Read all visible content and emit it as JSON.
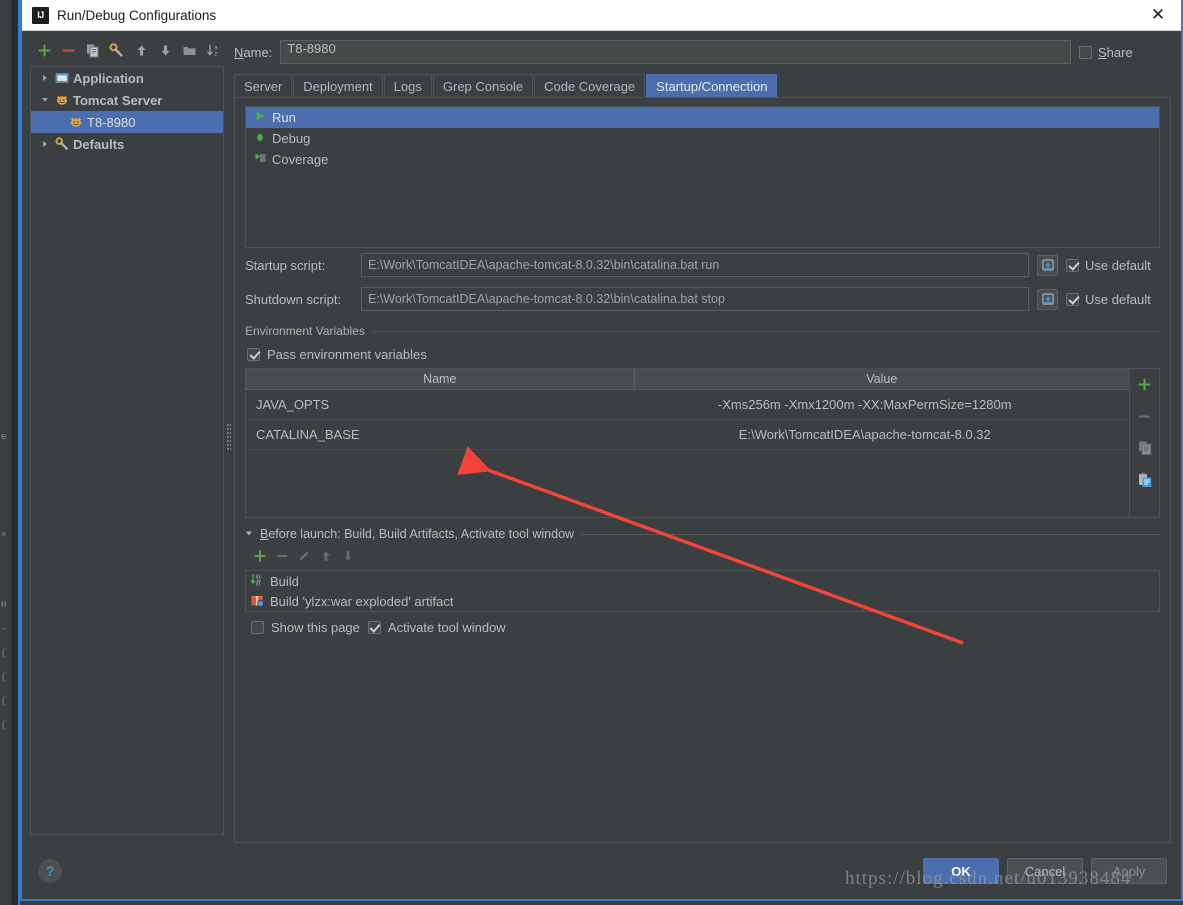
{
  "window": {
    "title": "Run/Debug Configurations",
    "icon": "intellij-idea-icon",
    "close_label": "✕"
  },
  "accent": {
    "selection_blue": "#4b6eaf",
    "border_blue": "#2d7fd0",
    "panel_bg": "#3c3f41",
    "text": "#bbbbbb",
    "green": "#4caf50",
    "red_arrow": "#f4443a"
  },
  "left_panel": {
    "toolbar": [
      {
        "name": "add-configuration-button",
        "icon": "plus-icon",
        "label": "+"
      },
      {
        "name": "remove-configuration-button",
        "icon": "minus-icon",
        "label": "−"
      },
      {
        "name": "copy-configuration-button",
        "icon": "copy-icon",
        "label": ""
      },
      {
        "name": "edit-defaults-button",
        "icon": "wrench-icon",
        "label": ""
      },
      {
        "name": "move-up-button",
        "icon": "arrow-up-icon",
        "label": ""
      },
      {
        "name": "move-down-button",
        "icon": "arrow-down-icon",
        "label": ""
      },
      {
        "name": "create-folder-button",
        "icon": "folder-icon",
        "label": ""
      },
      {
        "name": "sort-alphabetically-button",
        "icon": "sort-az-icon",
        "label": ""
      }
    ],
    "tree": [
      {
        "label": "Application",
        "icon": "application-icon",
        "twisty": "collapsed",
        "level": 0,
        "selected": false
      },
      {
        "label": "Tomcat Server",
        "icon": "tomcat-icon",
        "twisty": "expanded",
        "level": 0,
        "selected": false
      },
      {
        "label": "T8-8980",
        "icon": "tomcat-icon",
        "twisty": "none",
        "level": 1,
        "selected": true
      },
      {
        "label": "Defaults",
        "icon": "wrench-icon",
        "twisty": "collapsed",
        "level": 0,
        "selected": false
      }
    ]
  },
  "name_row": {
    "label": "Name:",
    "label_mnemonic": "N",
    "value": "T8-8980",
    "placeholder": "",
    "share_label": "Share",
    "share_mnemonic": "S",
    "share_checked": false
  },
  "tabs": [
    {
      "label": "Server",
      "active": false
    },
    {
      "label": "Deployment",
      "active": false
    },
    {
      "label": "Logs",
      "active": false
    },
    {
      "label": "Grep Console",
      "active": false
    },
    {
      "label": "Code Coverage",
      "active": false
    },
    {
      "label": "Startup/Connection",
      "active": true
    }
  ],
  "startup_connection": {
    "modes": [
      {
        "label": "Run",
        "icon": "run-triangle-icon",
        "selected": true
      },
      {
        "label": "Debug",
        "icon": "debug-bug-icon",
        "selected": false
      },
      {
        "label": "Coverage",
        "icon": "coverage-icon",
        "selected": false
      }
    ],
    "startup_script": {
      "label": "Startup script:",
      "value": "E:\\Work\\TomcatIDEA\\apache-tomcat-8.0.32\\bin\\catalina.bat run",
      "browse_icon": "browse-folder-icon",
      "use_default_label": "Use default",
      "use_default_checked": true
    },
    "shutdown_script": {
      "label": "Shutdown script:",
      "value": "E:\\Work\\TomcatIDEA\\apache-tomcat-8.0.32\\bin\\catalina.bat stop",
      "browse_icon": "browse-folder-icon",
      "use_default_label": "Use default",
      "use_default_checked": true
    },
    "environment_variables": {
      "section_title": "Environment Variables",
      "pass_env_label": "Pass environment variables",
      "pass_env_checked": true,
      "columns": [
        "Name",
        "Value"
      ],
      "rows": [
        {
          "name": "JAVA_OPTS",
          "value": "-Xms256m -Xmx1200m -XX:MaxPermSize=1280m"
        },
        {
          "name": "CATALINA_BASE",
          "value": "E:\\Work\\TomcatIDEA\\apache-tomcat-8.0.32"
        }
      ],
      "side_buttons": [
        {
          "name": "add-env-variable-button",
          "icon": "plus-icon"
        },
        {
          "name": "remove-env-variable-button",
          "icon": "minus-icon"
        },
        {
          "name": "copy-env-variable-button",
          "icon": "copy-icon"
        },
        {
          "name": "paste-env-variable-button",
          "icon": "paste-icon"
        }
      ]
    }
  },
  "before_launch": {
    "title": "Before launch: Build, Build Artifacts, Activate tool window",
    "title_mnemonic": "B",
    "toolbar": [
      {
        "name": "add-task-button",
        "icon": "plus-icon",
        "enabled": true
      },
      {
        "name": "remove-task-button",
        "icon": "minus-icon",
        "enabled": false
      },
      {
        "name": "edit-task-button",
        "icon": "pencil-icon",
        "enabled": false
      },
      {
        "name": "move-task-up-button",
        "icon": "arrow-up-icon",
        "enabled": false
      },
      {
        "name": "move-task-down-button",
        "icon": "arrow-down-icon",
        "enabled": false
      }
    ],
    "tasks": [
      {
        "label": "Build",
        "icon": "build-icon"
      },
      {
        "label": "Build 'ylzx:war exploded' artifact",
        "icon": "artifact-icon"
      }
    ],
    "show_this_page_label": "Show this page",
    "show_this_page_checked": false,
    "activate_tool_window_label": "Activate tool window",
    "activate_tool_window_checked": true
  },
  "footer": {
    "help_label": "?",
    "ok_label": "OK",
    "cancel_label": "Cancel",
    "apply_label": "Apply"
  },
  "watermark": "https://blog.csdn.net/u013938484"
}
